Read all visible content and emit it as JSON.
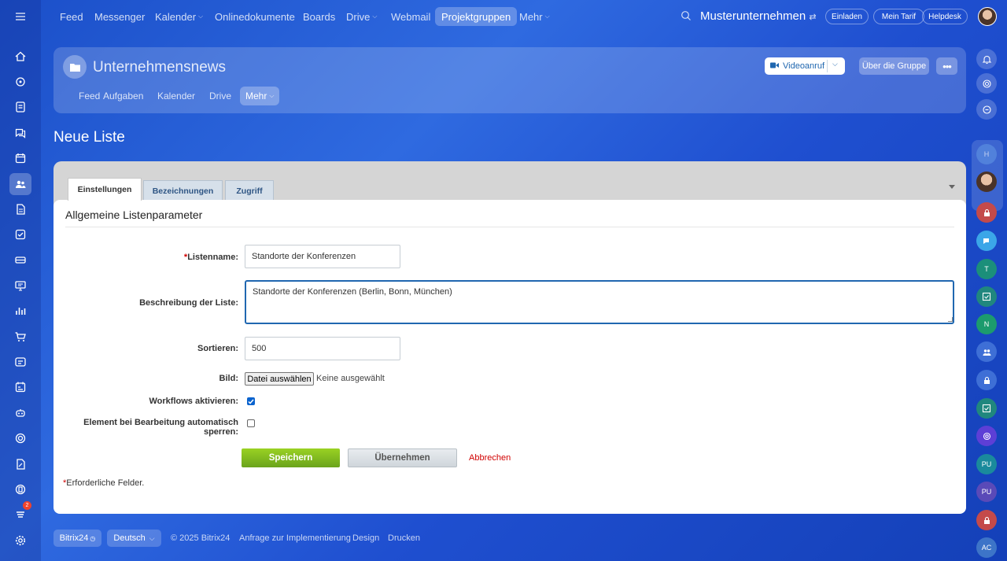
{
  "topnav": {
    "items": [
      {
        "label": "Feed"
      },
      {
        "label": "Messenger"
      },
      {
        "label": "Kalender"
      },
      {
        "label": "Onlinedokumente"
      },
      {
        "label": "Boards"
      },
      {
        "label": "Drive"
      },
      {
        "label": "Webmail"
      },
      {
        "label": "Projektgruppen"
      },
      {
        "label": "Mehr"
      }
    ],
    "active": "Projektgruppen",
    "company": "Musterunternehmen",
    "invite": "Einladen",
    "tariff": "Mein Tarif",
    "helpdesk": "Helpdesk"
  },
  "group": {
    "title": "Unternehmensnews",
    "tabs": [
      {
        "label": "Feed"
      },
      {
        "label": "Aufgaben"
      },
      {
        "label": "Kalender"
      },
      {
        "label": "Drive"
      },
      {
        "label": "Mehr"
      }
    ],
    "video_call": "Videoanruf",
    "about": "Über die Gruppe"
  },
  "page": {
    "title": "Neue Liste"
  },
  "form": {
    "tabs": [
      {
        "label": "Einstellungen"
      },
      {
        "label": "Bezeichnungen"
      },
      {
        "label": "Zugriff"
      }
    ],
    "section_title": "Allgemeine Listenparameter",
    "required_mark": "*",
    "fields": {
      "name_label": "Listenname:",
      "name_value": "Standorte der Konferenzen",
      "desc_label": "Beschreibung der Liste:",
      "desc_value": "Standorte der Konferenzen (Berlin, Bonn, München)",
      "sort_label": "Sortieren:",
      "sort_value": "500",
      "image_label": "Bild:",
      "file_button": "Datei auswählen",
      "file_none": "Keine ausgewählt",
      "workflow_label": "Workflows aktivieren:",
      "workflow_checked": true,
      "lock_label_1": "Element bei Bearbeitung automatisch",
      "lock_label_2": "sperren:",
      "lock_checked": false
    },
    "buttons": {
      "save": "Speichern",
      "apply": "Übernehmen",
      "cancel": "Abbrechen"
    },
    "required_note": "Erforderliche Felder."
  },
  "rightbar": {
    "avatars": [
      "H",
      "T",
      "N",
      "PU",
      "PU",
      "AC"
    ]
  },
  "leftbar": {
    "notification_count": "2"
  },
  "footer": {
    "brand": "Bitrix24",
    "language": "Deutsch",
    "copyright": "© 2025 Bitrix24",
    "links": [
      "Anfrage zur Implementierung",
      "Design",
      "Drucken"
    ]
  },
  "colors": {
    "accent": "#2067b0",
    "save_green": "#7bb51f",
    "required_red": "#d10000"
  }
}
